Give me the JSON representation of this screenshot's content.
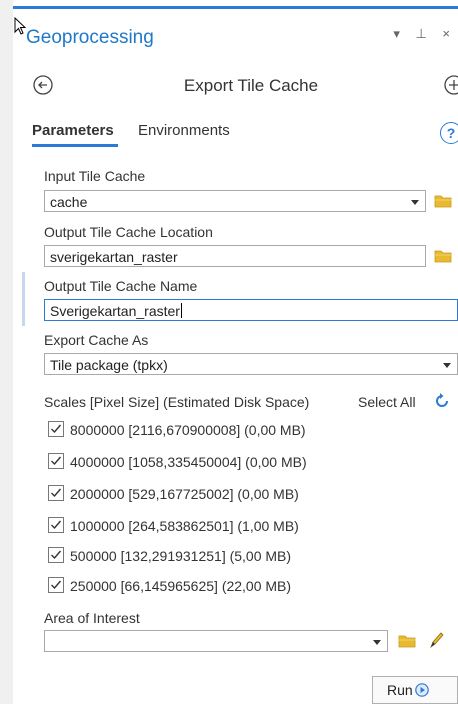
{
  "pane": {
    "title": "Geoprocessing",
    "controls": "▾ ⊥ ×"
  },
  "tool": {
    "title": "Export Tile Cache"
  },
  "tabs": {
    "parameters": "Parameters",
    "environments": "Environments",
    "help": "?"
  },
  "input_tile_cache": {
    "label": "Input Tile Cache",
    "value": "cache"
  },
  "output_location": {
    "label": "Output Tile Cache Location",
    "value": "sverigekartan_raster"
  },
  "output_name": {
    "label": "Output Tile Cache Name",
    "value": "Sverigekartan_raster"
  },
  "export_as": {
    "label": "Export Cache As",
    "value": "Tile package (tpkx)"
  },
  "scales": {
    "header": "Scales [Pixel Size] (Estimated Disk Space)",
    "select_all": "Select All",
    "items": [
      {
        "label": "8000000 [2116,670900008] (0,00 MB)",
        "checked": true
      },
      {
        "label": "4000000 [1058,335450004] (0,00 MB)",
        "checked": true
      },
      {
        "label": "2000000 [529,167725002] (0,00 MB)",
        "checked": true
      },
      {
        "label": "1000000 [264,583862501] (1,00 MB)",
        "checked": true
      },
      {
        "label": "500000 [132,291931251] (5,00 MB)",
        "checked": true
      },
      {
        "label": "250000 [66,145965625] (22,00 MB)",
        "checked": true
      }
    ]
  },
  "area_of_interest": {
    "label": "Area of Interest",
    "value": ""
  },
  "run": {
    "label": "Run"
  },
  "colors": {
    "accent": "#2b7bd6",
    "title_blue": "#2079c7",
    "folder": "#e8b931"
  }
}
